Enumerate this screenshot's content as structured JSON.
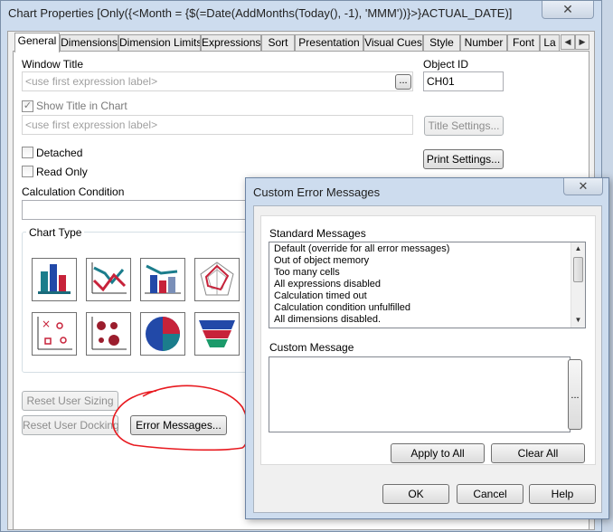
{
  "window": {
    "title": "Chart Properties [Only({<Month = {$(=Date(AddMonths(Today(), -1), 'MMM'))}>}ACTUAL_DATE)]",
    "close_glyph": "✕"
  },
  "tabs": [
    {
      "label": "General",
      "active": true
    },
    {
      "label": "Dimensions"
    },
    {
      "label": "Dimension Limits"
    },
    {
      "label": "Expressions"
    },
    {
      "label": "Sort"
    },
    {
      "label": "Presentation"
    },
    {
      "label": "Visual Cues"
    },
    {
      "label": "Style"
    },
    {
      "label": "Number"
    },
    {
      "label": "Font"
    },
    {
      "label": "La"
    }
  ],
  "tab_scroll": {
    "left": "◀",
    "right": "▶"
  },
  "general": {
    "window_title_label": "Window Title",
    "window_title_placeholder": "<use first expression label>",
    "window_title_ellipsis": "...",
    "object_id_label": "Object ID",
    "object_id_value": "CH01",
    "show_title_label": "Show Title in Chart",
    "show_title_checked": true,
    "show_title_placeholder": "<use first expression label>",
    "title_settings_button": "Title Settings...",
    "detached_label": "Detached",
    "read_only_label": "Read Only",
    "print_settings_button": "Print Settings...",
    "calculation_condition_label": "Calculation Condition",
    "chart_type_label": "Chart Type",
    "reset_user_sizing_button": "Reset User Sizing",
    "reset_user_docking_button": "Reset User Docking",
    "error_messages_button": "Error Messages..."
  },
  "chart_types": [
    "bar-chart-icon",
    "line-chart-icon",
    "combo-chart-icon",
    "radar-chart-icon",
    "scatter-chart-icon",
    "grid-chart-icon",
    "pie-chart-icon",
    "funnel-chart-icon"
  ],
  "dialog": {
    "title": "Custom Error Messages",
    "close_glyph": "✕",
    "standard_messages_label": "Standard Messages",
    "standard_messages": [
      "Default (override for all error messages)",
      "Out of object memory",
      "Too many cells",
      "All expressions disabled",
      "Calculation timed out",
      "Calculation condition unfulfilled",
      "All dimensions disabled."
    ],
    "custom_message_label": "Custom Message",
    "custom_message_value": "",
    "custom_message_ellipsis": "...",
    "apply_to_all_button": "Apply to All",
    "clear_all_button": "Clear All",
    "ok_button": "OK",
    "cancel_button": "Cancel",
    "help_button": "Help"
  },
  "colors": {
    "annotation_circle": "#e8191f",
    "frame": "#cddcee"
  }
}
